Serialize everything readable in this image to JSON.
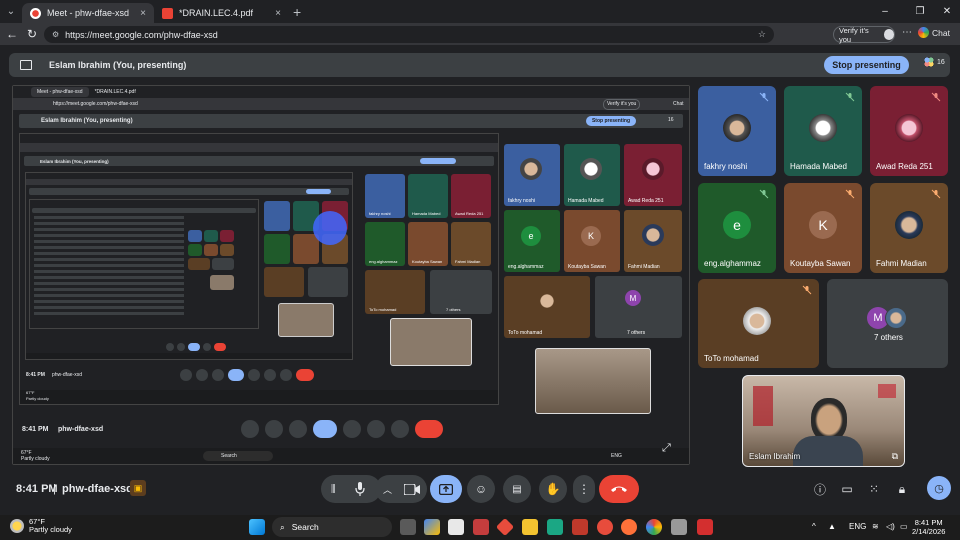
{
  "browser": {
    "tabs": [
      {
        "label": "Meet - phw-dfae-xsd",
        "favicon": "meet-recording-icon",
        "close": "×"
      },
      {
        "label": "*DRAIN.LEC.4.pdf",
        "favicon": "pdf-icon",
        "close": "×"
      }
    ],
    "new_tab": "+",
    "window_controls": [
      "–",
      "❐",
      "✕"
    ],
    "url": "https://meet.google.com/phw-dfae-xsd",
    "verify_label": "Verify it's you",
    "chat_label": "Chat"
  },
  "meet": {
    "presenting_label": "Eslam Ibrahim (You, presenting)",
    "stop_presenting": "Stop presenting",
    "participant_count": "16",
    "time": "8:41 PM",
    "separator": "|",
    "meeting_code": "phw-dfae-xsd",
    "participants": [
      {
        "name": "fakhry noshi",
        "type": "photo",
        "bg": "#3b5fa0",
        "muted": true
      },
      {
        "name": "Hamada Mabed",
        "type": "photo",
        "bg": "#1f5a4b",
        "muted": true
      },
      {
        "name": "Awad Reda 251",
        "type": "photo",
        "bg": "#7a1f33",
        "muted": true
      },
      {
        "name": "eng.alghammaz",
        "type": "letter",
        "letter": "e",
        "bg": "#1f5a2a",
        "circle": "#1e8e3e",
        "muted": true
      },
      {
        "name": "Koutayba Sawan",
        "type": "letter",
        "letter": "K",
        "bg": "#7a4a2e",
        "circle": "#9a6a50",
        "muted": true
      },
      {
        "name": "Fahmi Madian",
        "type": "photo",
        "bg": "#6b4a2a",
        "muted": true
      },
      {
        "name": "ToTo mohamad",
        "type": "photo",
        "bg": "#5a3e24",
        "muted": true
      },
      {
        "name": "7 others",
        "type": "others",
        "letter": "M",
        "bg": "#3c4043"
      }
    ],
    "self_view_name": "Eslam Ibrahim",
    "nested": {
      "presenting_label": "Eslam Ibrahim (You, presenting)",
      "stop_presenting": "Stop presenting",
      "count": "16",
      "url": "https://meet.google.com/phw-dfae-xsd",
      "tab1": "Meet - phw-dfae-xsd",
      "tab2": "*DRAIN.LEC.4.pdf",
      "verify": "Verify it's you",
      "chat": "Chat",
      "time": "8:41 PM",
      "code": "phw-dfae-xsd",
      "weather_temp": "67°F",
      "weather_desc": "Partly cloudy",
      "search": "Search",
      "lang": "ENG"
    }
  },
  "taskbar": {
    "weather_temp": "67°F",
    "weather_desc": "Partly cloudy",
    "search_placeholder": "Search",
    "tray_arrow": "^",
    "language": "ENG",
    "time": "8:41 PM",
    "date": "2/14/2026"
  },
  "colors": {
    "accent_blue": "#8ab4f8",
    "hangup_red": "#ea4335",
    "background": "#202124",
    "host_badge": "#fbbc04"
  }
}
